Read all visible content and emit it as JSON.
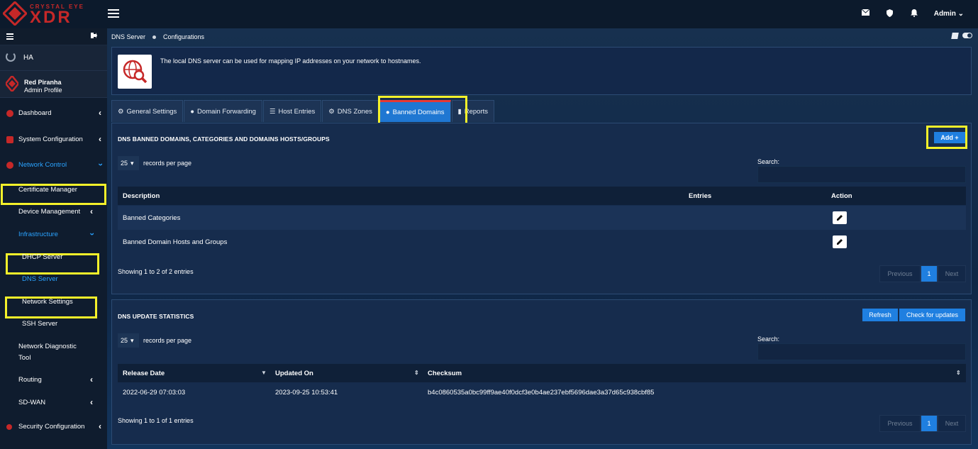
{
  "brand": {
    "tagline": "CRYSTAL EYE",
    "name": "XDR",
    "color": "#c62828"
  },
  "topbar": {
    "icons": [
      "mail-icon",
      "shield-icon",
      "bell-icon"
    ],
    "user": "Admin"
  },
  "sidebar": {
    "ha_label": "HA",
    "profile": {
      "name": "Red Piranha",
      "role": "Admin Profile"
    },
    "items": [
      {
        "label": "Dashboard"
      },
      {
        "label": "System Configuration"
      },
      {
        "label": "Network Control"
      },
      {
        "label": "Certificate Manager"
      },
      {
        "label": "Device Management"
      },
      {
        "label": "Infrastructure"
      },
      {
        "label": "DHCP Server"
      },
      {
        "label": "DNS Server"
      },
      {
        "label": "Network Settings"
      },
      {
        "label": "SSH Server"
      },
      {
        "label": "Network Diagnostic"
      },
      {
        "label": "Tool"
      },
      {
        "label": "Routing"
      },
      {
        "label": "SD-WAN"
      },
      {
        "label": "Security Configuration"
      }
    ]
  },
  "breadcrumb": {
    "first": "DNS Server",
    "second": "Configurations"
  },
  "info": {
    "text": "The local DNS server can be used for mapping IP addresses on your network to hostnames."
  },
  "tabs": [
    {
      "label": "General Settings"
    },
    {
      "label": "Domain Forwarding"
    },
    {
      "label": "Host Entries"
    },
    {
      "label": "DNS Zones"
    },
    {
      "label": "Banned Domains"
    },
    {
      "label": "Reports"
    }
  ],
  "banned_panel": {
    "title": "DNS BANNED DOMAINS, CATEGORIES AND DOMAINS HOSTS/GROUPS",
    "add_label": "Add +",
    "records_value": "25",
    "records_label": "records per page",
    "search_label": "Search:",
    "columns": {
      "description": "Description",
      "entries": "Entries",
      "action": "Action"
    },
    "rows": [
      {
        "description": "Banned Categories"
      },
      {
        "description": "Banned Domain Hosts and Groups"
      }
    ],
    "footer": "Showing 1 to 2 of 2 entries",
    "pager": {
      "prev": "Previous",
      "page": "1",
      "next": "Next"
    }
  },
  "stats_panel": {
    "title": "DNS UPDATE STATISTICS",
    "refresh_label": "Refresh",
    "check_label": "Check for updates",
    "records_value": "25",
    "records_label": "records per page",
    "search_label": "Search:",
    "columns": {
      "release": "Release Date",
      "updated": "Updated On",
      "checksum": "Checksum"
    },
    "rows": [
      {
        "release": "2022-06-29 07:03:03",
        "updated": "2023-09-25 10:53:41",
        "checksum": "b4c0860535a0bc99ff9ae40f0dcf3e0b4ae237ebf5696dae3a37d65c938cbf85"
      }
    ],
    "footer": "Showing 1 to 1 of 1 entries",
    "pager": {
      "prev": "Previous",
      "page": "1",
      "next": "Next"
    }
  },
  "colors": {
    "accent": "#1f7fe0",
    "highlight": "#f5f12a",
    "active_nav": "#2aa3ff"
  }
}
